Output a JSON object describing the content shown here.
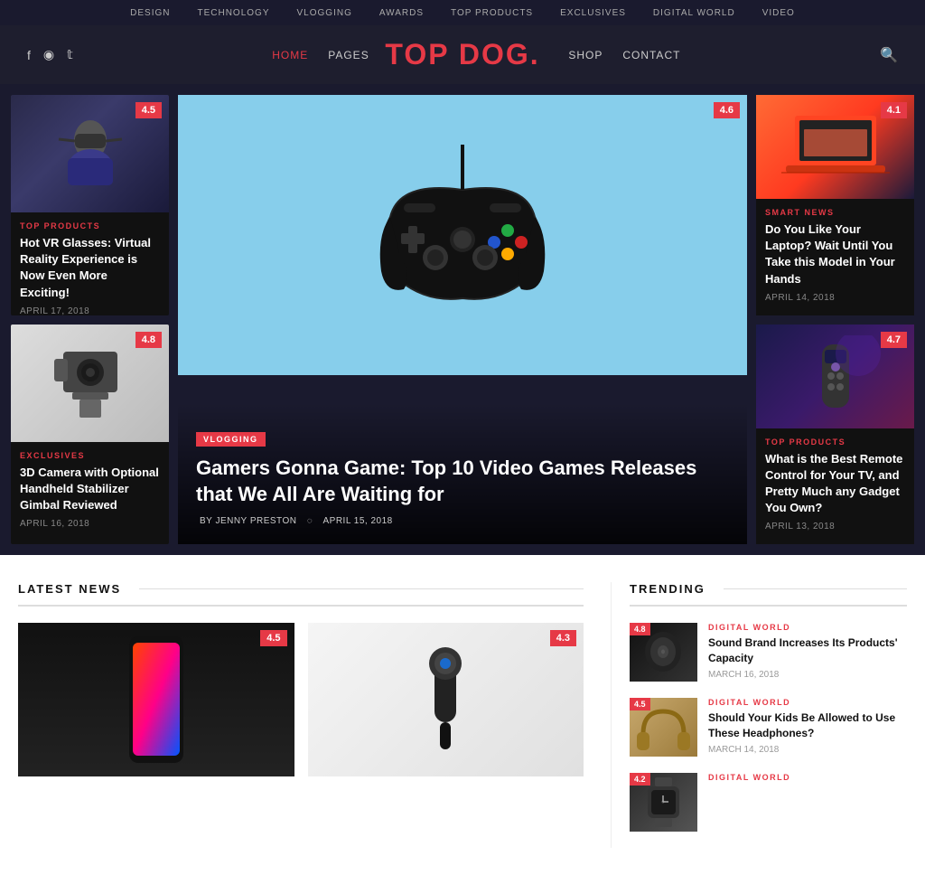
{
  "topnav": {
    "items": [
      "Design",
      "Technology",
      "Vlogging",
      "Awards",
      "Top Products",
      "Exclusives",
      "Digital World",
      "Video"
    ]
  },
  "header": {
    "social": [
      "f",
      "◉",
      "t"
    ],
    "nav_left": [
      {
        "label": "Home",
        "active": true
      },
      {
        "label": "Pages",
        "active": false
      }
    ],
    "title": "TOP DOG",
    "title_dot": ".",
    "nav_right": [
      {
        "label": "Shop"
      },
      {
        "label": "Contact"
      }
    ],
    "search_icon": "🔍"
  },
  "hero": {
    "left_cards": [
      {
        "rating": "4.5",
        "category": "Top Products",
        "title": "Hot VR Glasses: Virtual Reality Experience is Now Even More Exciting!",
        "date": "April 17, 2018"
      },
      {
        "rating": "4.8",
        "category": "Exclusives",
        "title": "3D Camera with Optional Handheld Stabilizer Gimbal Reviewed",
        "date": "April 16, 2018"
      }
    ],
    "center": {
      "rating": "4.6",
      "category": "Vlogging",
      "title": "Gamers Gonna Game: Top 10 Video Games Releases that We All Are Waiting for",
      "by": "By Jenny Preston",
      "date": "April 15, 2018"
    },
    "right_cards": [
      {
        "rating": "4.1",
        "category": "Smart News",
        "title": "Do You Like Your Laptop? Wait Until You Take this Model in Your Hands",
        "date": "April 14, 2018"
      },
      {
        "rating": "4.7",
        "category": "Top Products",
        "title": "What is the Best Remote Control for Your TV, and Pretty Much any Gadget You Own?",
        "date": "April 13, 2018"
      }
    ]
  },
  "latest_news": {
    "section_title": "Latest News",
    "cards": [
      {
        "rating": "4.5",
        "title": ""
      },
      {
        "rating": "4.3",
        "title": ""
      }
    ]
  },
  "trending": {
    "section_title": "Trending",
    "items": [
      {
        "rating": "4.8",
        "category": "Digital World",
        "title": "Sound Brand Increases Its Products' Capacity",
        "date": "March 16, 2018"
      },
      {
        "rating": "4.5",
        "category": "Digital World",
        "title": "Should Your Kids Be Allowed to Use These Headphones?",
        "date": "March 14, 2018"
      },
      {
        "rating": "4.2",
        "category": "Digital World",
        "title": "",
        "date": ""
      }
    ]
  }
}
